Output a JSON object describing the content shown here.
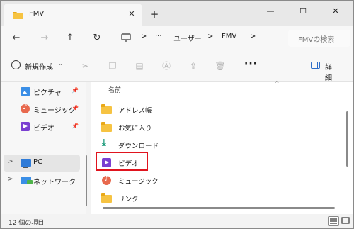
{
  "window": {
    "tab_title": "FMV",
    "new_tab": "+",
    "close_tab": "✕",
    "minimize": "—",
    "maximize": "☐",
    "close": "✕"
  },
  "nav": {
    "back": "←",
    "forward": "→",
    "up": "↑",
    "refresh": "↻"
  },
  "address": {
    "ellipsis": "···",
    "separator": ">",
    "crumbs": [
      "ユーザー",
      "FMV"
    ]
  },
  "search": {
    "placeholder": "FMVの検索"
  },
  "command_bar": {
    "new_label": "新規作成",
    "new_chevron": "⌄",
    "more": "···",
    "details_label": "詳細"
  },
  "sidebar": {
    "quick_access": [
      {
        "label": "ピクチャ",
        "icon": "pictures-icon",
        "pinned": true
      },
      {
        "label": "ミュージック",
        "icon": "music-icon",
        "pinned": true
      },
      {
        "label": "ビデオ",
        "icon": "videos-icon",
        "pinned": true
      }
    ],
    "pc": {
      "label": "PC",
      "icon": "pc-icon",
      "selected": true
    },
    "network": {
      "label": "ネットワーク",
      "icon": "network-icon"
    }
  },
  "main": {
    "column_header": "名前",
    "sort_indicator": "^",
    "items": [
      {
        "label": "アドレス帳",
        "icon": "folder-icon"
      },
      {
        "label": "お気に入り",
        "icon": "folder-icon"
      },
      {
        "label": "ダウンロード",
        "icon": "download-icon"
      },
      {
        "label": "ビデオ",
        "icon": "videos-icon",
        "highlighted": true
      },
      {
        "label": "ミュージック",
        "icon": "music-icon"
      },
      {
        "label": "リンク",
        "icon": "folder-icon"
      }
    ]
  },
  "status": {
    "item_count": "12 個の項目"
  },
  "colors": {
    "highlight_border": "#e0141e",
    "folder": "#f6c342",
    "video": "#7a3fd1",
    "music": "#e8694e"
  }
}
